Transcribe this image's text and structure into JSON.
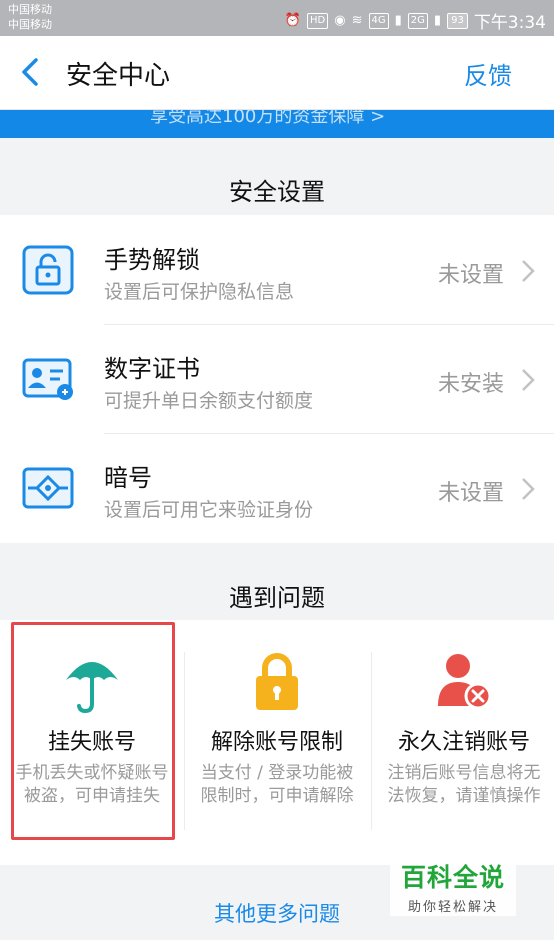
{
  "status_bar": {
    "carrier_1": "中国移动",
    "carrier_2": "中国移动",
    "hd_badge": "HD",
    "signal_4g": "4G",
    "signal_2g": "2G",
    "battery": "93",
    "time": "下午3:34"
  },
  "nav": {
    "title": "安全中心",
    "feedback": "反馈"
  },
  "banner": {
    "text": "享受高达100万的资金保障 >"
  },
  "security_settings": {
    "header": "安全设置",
    "items": [
      {
        "title": "手势解锁",
        "desc": "设置后可保护隐私信息",
        "status": "未设置",
        "icon": "lock-icon"
      },
      {
        "title": "数字证书",
        "desc": "可提升单日余额支付额度",
        "status": "未安装",
        "icon": "id-card-icon"
      },
      {
        "title": "暗号",
        "desc": "设置后可用它来验证身份",
        "status": "未设置",
        "icon": "code-icon"
      }
    ]
  },
  "problems": {
    "header": "遇到问题",
    "items": [
      {
        "title": "挂失账号",
        "desc": "手机丢失或怀疑账号被盗，可申请挂失",
        "icon": "umbrella-icon"
      },
      {
        "title": "解除账号限制",
        "desc": "当支付 / 登录功能被限制时，可申请解除",
        "icon": "padlock-icon"
      },
      {
        "title": "永久注销账号",
        "desc": "注销后账号信息将无法恢复，请谨慎操作",
        "icon": "remove-user-icon"
      }
    ],
    "more_link": "其他更多问题"
  },
  "watermark": {
    "title": "百科全说",
    "subtitle": "助你轻松解决"
  },
  "colors": {
    "accent_blue": "#1a8ae6",
    "icon_teal": "#1ea898",
    "icon_yellow": "#f5b21d",
    "icon_red": "#e8504a",
    "highlight_red": "#e5474a"
  }
}
